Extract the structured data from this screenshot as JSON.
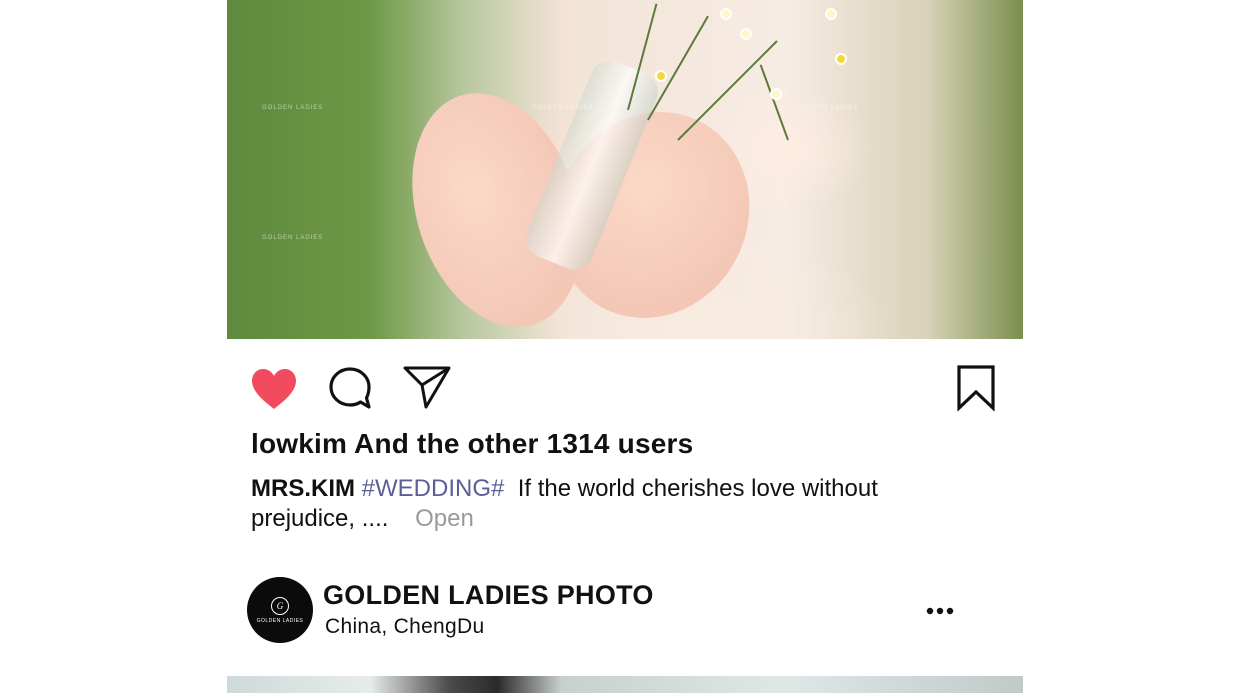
{
  "post": {
    "photo": {
      "description": "bride-holding-glass-vase-with-wildflowers",
      "watermark": "GOLDEN LADIES"
    },
    "actions": {
      "like_icon": "heart-icon",
      "comment_icon": "comment-icon",
      "share_icon": "send-icon",
      "save_icon": "bookmark-icon",
      "like_color": "#f24a5f"
    },
    "likes_text": "lowkim And the other 1314 users",
    "caption": {
      "username": "MRS.KIM",
      "hashtag": "#WEDDING#",
      "text_line1": "If the world cherishes love without",
      "text_line2": "prejudice, ....",
      "open_label": "Open"
    }
  },
  "next_post": {
    "avatar": {
      "logo_mark": "G",
      "logo_text": "GOLDEN LADIES"
    },
    "account_name": "GOLDEN LADIES PHOTO",
    "location": "China,  ChengDu",
    "more_icon": "more-dots-icon"
  }
}
